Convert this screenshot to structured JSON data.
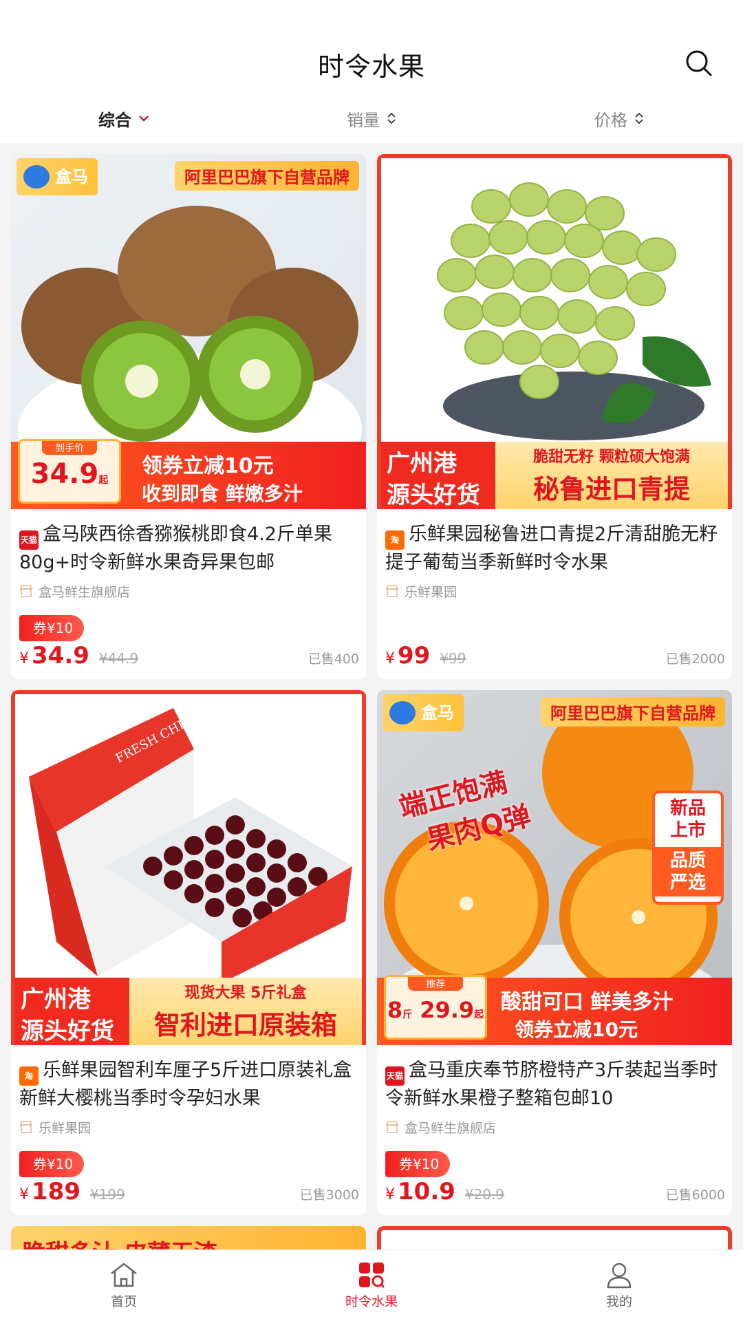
{
  "header": {
    "title": "时令水果"
  },
  "sort": [
    {
      "label": "综合",
      "active": true
    },
    {
      "label": "销量",
      "active": false
    },
    {
      "label": "价格",
      "active": false
    }
  ],
  "products": [
    {
      "title": "盒马陕西徐香猕猴桃即食4.2斤单果80g+时令新鲜水果奇异果包邮",
      "source": "tmall",
      "store": "盒马鲜生旗舰店",
      "coupon": "券¥10",
      "price": "34.9",
      "original_price": "¥44.9",
      "sold": "已售400",
      "image": {
        "top_tag": "阿里巴巴旗下自营品牌",
        "logo": "盒马",
        "badge_label": "到手价",
        "badge_price": "34.9",
        "badge_unit": "起",
        "line1": "领券立减10元",
        "line2": "收到即食 鲜嫩多汁"
      }
    },
    {
      "title": "乐鲜果园秘鲁进口青提2斤清甜脆无籽提子葡萄当季新鲜时令水果",
      "source": "taobao",
      "store": "乐鲜果园",
      "coupon": "",
      "price": "99",
      "original_price": "¥99",
      "sold": "已售2000",
      "image": {
        "left1": "广州港",
        "left2": "源头好货",
        "line1": "脆甜无籽 颗粒硕大饱满",
        "line2": "秘鲁进口青提"
      }
    },
    {
      "title": "乐鲜果园智利车厘子5斤进口原装礼盒新鲜大樱桃当季时令孕妇水果",
      "source": "taobao",
      "store": "乐鲜果园",
      "coupon": "券¥10",
      "price": "189",
      "original_price": "¥199",
      "sold": "已售3000",
      "image": {
        "left1": "广州港",
        "left2": "源头好货",
        "line1": "现货大果 5斤礼盒",
        "line2": "智利进口原装箱",
        "box_text": "FRESH CHERRIES"
      }
    },
    {
      "title": "盒马重庆奉节脐橙特产3斤装起当季时令新鲜水果橙子整箱包邮10",
      "source": "tmall",
      "store": "盒马鲜生旗舰店",
      "coupon": "券¥10",
      "price": "10.9",
      "original_price": "¥20.9",
      "sold": "已售6000",
      "image": {
        "top_tag": "阿里巴巴旗下自营品牌",
        "logo": "盒马",
        "slogan1": "端正饱满",
        "slogan2": "果肉Q弹",
        "side1": "新品",
        "side2": "上市",
        "side3": "品质",
        "side4": "严选",
        "badge_label": "推荐",
        "badge_weight": "8",
        "badge_weight_unit": "斤",
        "badge_price": "29.9",
        "badge_unit": "起",
        "line1": "酸甜可口 鲜美多汁",
        "line2": "领券立减10元"
      }
    }
  ],
  "peek": {
    "text": "脆甜多汁 皮薄无渣"
  },
  "source_badges": {
    "tmall": "天猫",
    "taobao": "淘"
  },
  "tabbar": [
    {
      "label": "首页",
      "icon": "home-icon",
      "active": false
    },
    {
      "label": "时令水果",
      "icon": "category-icon",
      "active": true
    },
    {
      "label": "我的",
      "icon": "user-icon",
      "active": false
    }
  ],
  "colors": {
    "accent": "#e0161f",
    "background": "#f4f4f4"
  }
}
